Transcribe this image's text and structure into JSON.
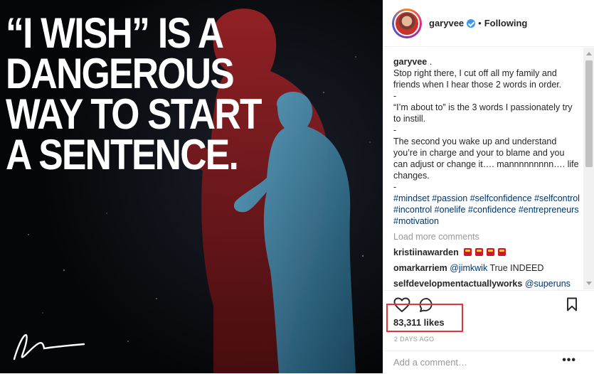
{
  "photo": {
    "quote_lines": [
      "“I WISH” IS A",
      "DANGEROUS",
      "WAY TO START",
      "A SENTENCE."
    ],
    "signature": "Gary Vaynerchuk signature",
    "colors": {
      "background": "#07080c",
      "red_figure": "#8f1b1e",
      "blue_figure": "#3e86a8"
    }
  },
  "header": {
    "username": "garyvee",
    "verified_icon": "verified-badge-icon",
    "separator": "•",
    "follow_state": "Following"
  },
  "caption": {
    "username": "garyvee",
    "after_username": " .",
    "lines": [
      "Stop right there, I cut off all my family and friends when I hear those 2 words in order.",
      "-",
      "“I’m about to” is the 3 words I passionately try to instill.",
      "-",
      "The second you wake up and understand you’re in charge and your to blame and you can adjust or change it…. mannnnnnnnn…. life changes.",
      "-"
    ],
    "hashtags": "#mindset #passion #selfconfidence #selfcontrol #incontrol #onelife #confidence #entrepreneurs #motivation"
  },
  "load_more": "Load more comments",
  "comments": [
    {
      "user": "kristiinawarden",
      "text": "",
      "emoji": [
        "100-icon",
        "100-icon",
        "100-icon",
        "100-icon"
      ]
    },
    {
      "user": "omarkarriem",
      "mention": "@jimkwik",
      "text": " True INDEED"
    },
    {
      "user": "selfdevelopmentactuallyworks",
      "mention": "@superuns",
      "text": ""
    }
  ],
  "actions": {
    "like_icon": "heart-icon",
    "comment_icon": "comment-bubble-icon",
    "save_icon": "bookmark-icon"
  },
  "likes": "83,311 likes",
  "timestamp": "2 DAYS AGO",
  "add_comment": {
    "placeholder": "Add a comment…",
    "value": ""
  },
  "more_options": "•••",
  "colors": {
    "link": "#003569",
    "muted": "#999999",
    "text": "#262626",
    "highlight_box": "#e0353b",
    "verified": "#3897f0"
  }
}
